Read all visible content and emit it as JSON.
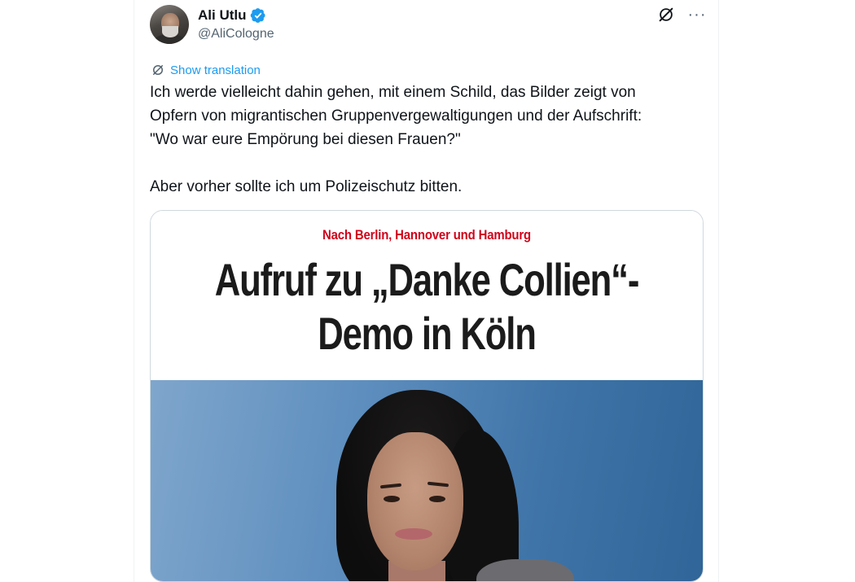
{
  "author": {
    "name": "Ali Utlu",
    "handle": "@AliCologne",
    "verified": true
  },
  "icons": {
    "verified": "verified-badge-icon",
    "grok": "grok-icon",
    "more": "more-options-icon",
    "translate": "translate-icon"
  },
  "translation": {
    "label": "Show translation"
  },
  "tweet": {
    "text": "Ich werde vielleicht dahin gehen, mit einem Schild, das Bilder zeigt von\nOpfern von migrantischen Gruppenvergewaltigungen und der Aufschrift:\n\"Wo war eure Empörung bei diesen Frauen?\"\n\nAber vorher sollte ich um Polizeischutz bitten."
  },
  "media": {
    "kicker": "Nach Berlin, Hannover und Hamburg",
    "headline_line1": "Aufruf zu „Danke Collien“-",
    "headline_line2": "Demo in Köln"
  },
  "colors": {
    "link": "#1d9bf0",
    "verified": "#1d9bf0",
    "kicker": "#d0021b",
    "text": "#0f1419",
    "secondary": "#536471"
  }
}
